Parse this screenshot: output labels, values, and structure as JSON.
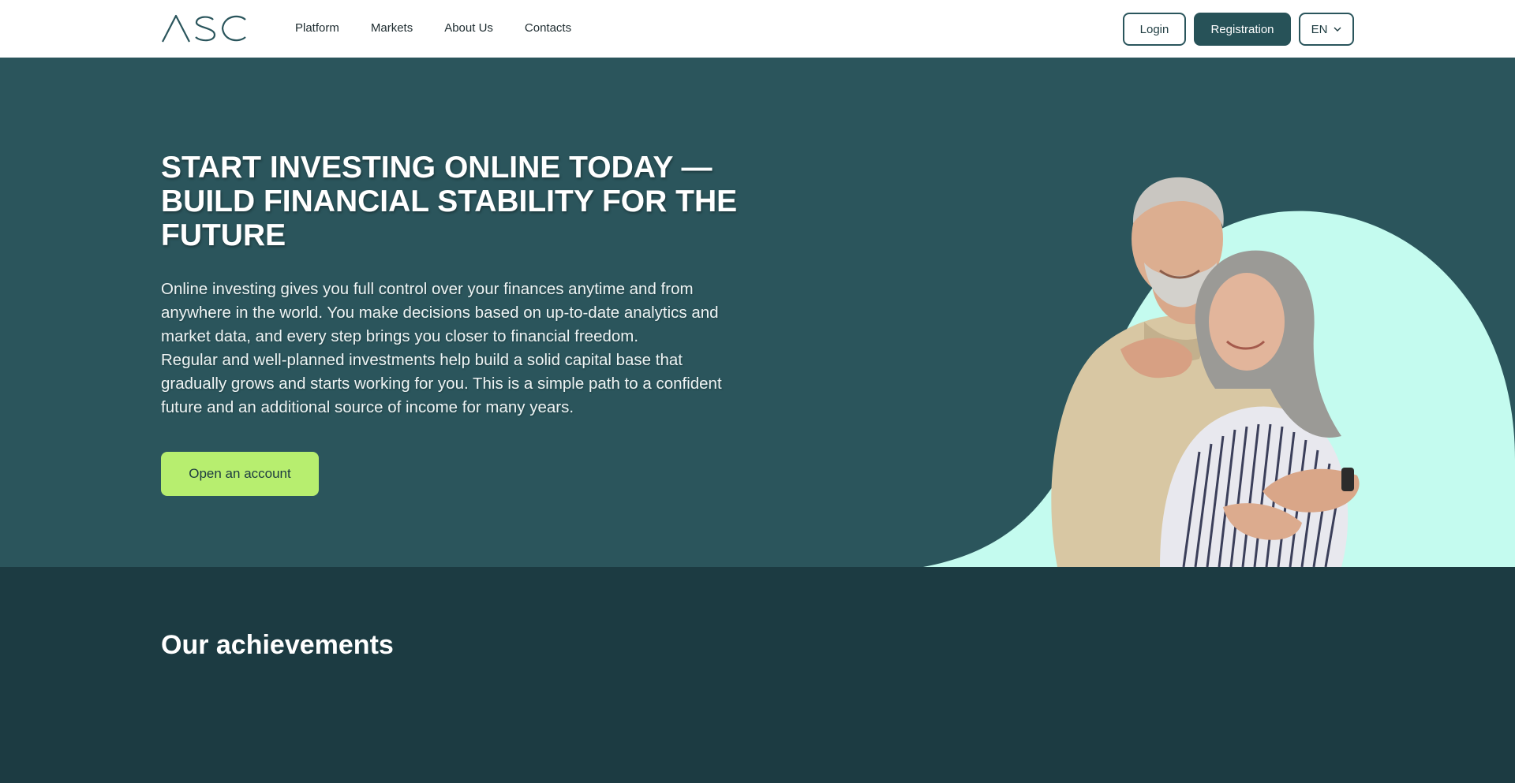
{
  "header": {
    "logo_text": "ASC",
    "nav": [
      "Platform",
      "Markets",
      "About Us",
      "Contacts"
    ],
    "login_label": "Login",
    "registration_label": "Registration",
    "language": "EN"
  },
  "hero": {
    "title": "START INVESTING ONLINE TODAY — BUILD FINANCIAL STABILITY FOR THE FUTURE",
    "paragraph1": "Online investing gives you full control over your finances anytime and from anywhere in the world. You make decisions based on up-to-date analytics and market data, and every step brings you closer to financial freedom.",
    "paragraph2": "Regular and well-planned investments help build a solid capital base that gradually grows and starts working for you. This is a simple path to a confident future and an additional source of income for many years.",
    "cta_label": "Open an account"
  },
  "achievements": {
    "title": "Our achievements"
  },
  "colors": {
    "hero_bg": "#2b555c",
    "section_bg": "#1c3b42",
    "accent_green": "#b7ee6f",
    "blob_mint": "#c4fbef",
    "button_dark": "#275258"
  },
  "icons": [
    "chevron-down-icon"
  ]
}
